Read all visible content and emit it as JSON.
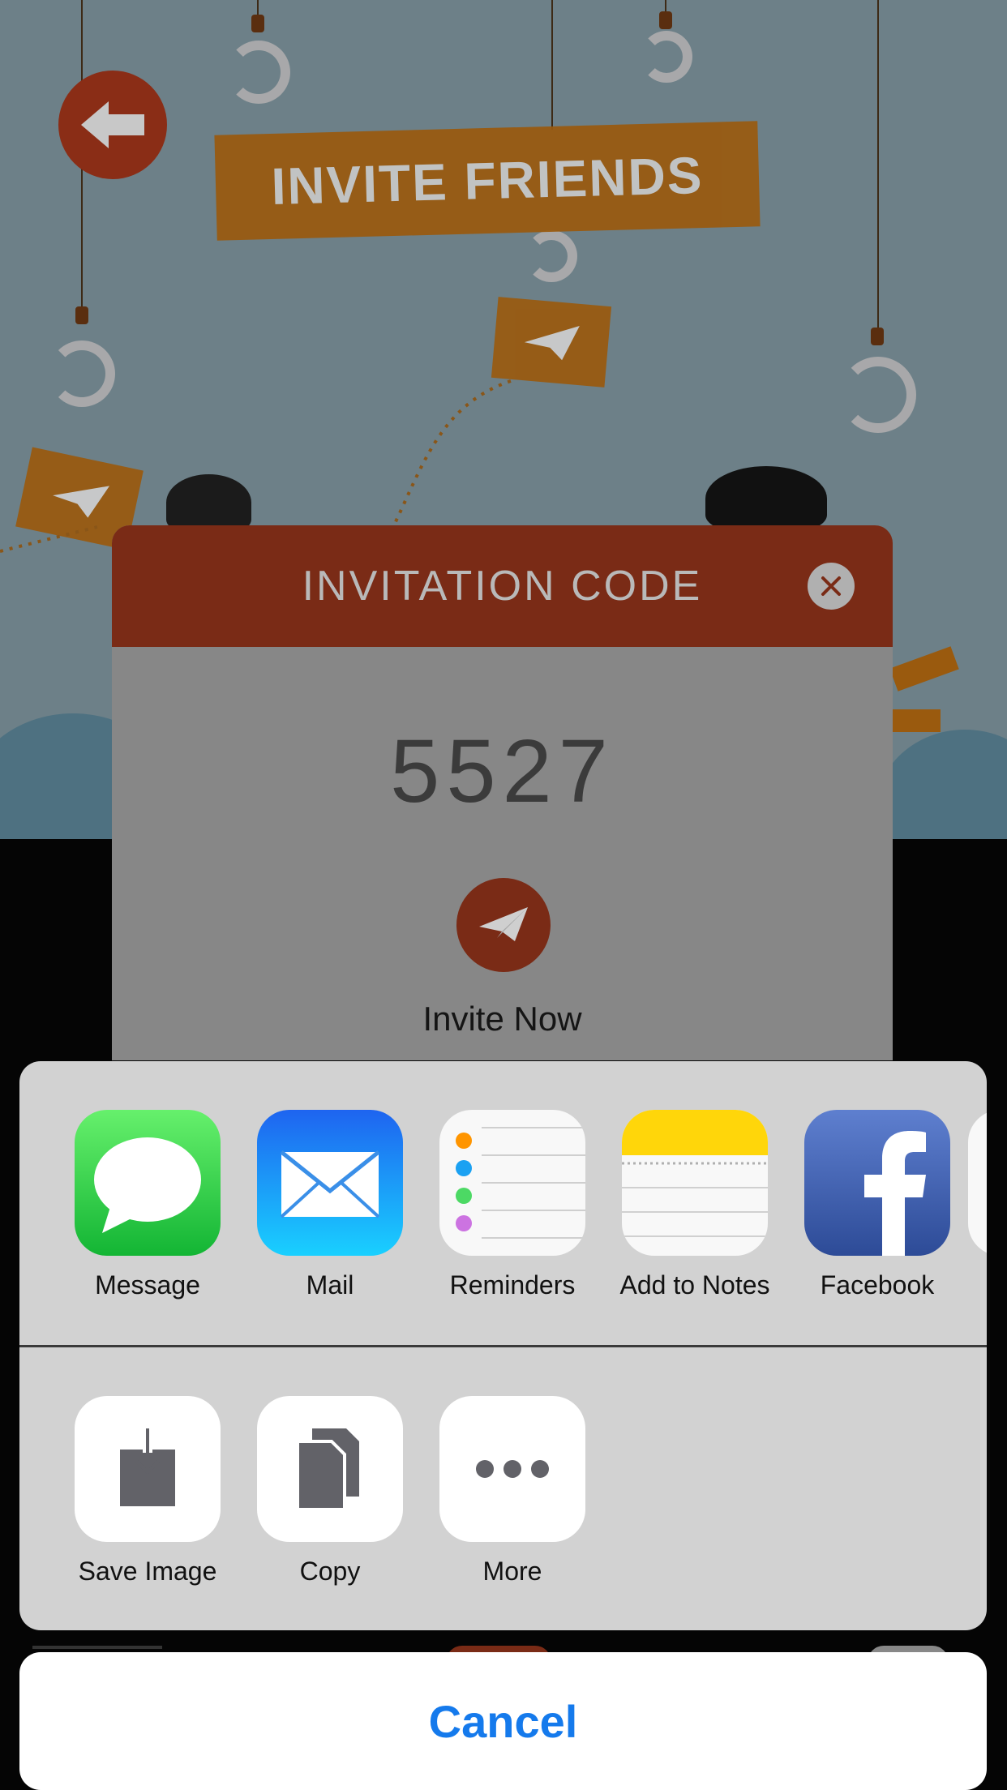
{
  "scene": {
    "banner_title": "INVITE FRIENDS"
  },
  "modal": {
    "title": "INVITATION CODE",
    "code": "5527",
    "invite_label": "Invite Now"
  },
  "share_sheet": {
    "apps": [
      {
        "label": "Message",
        "icon": "message-icon"
      },
      {
        "label": "Mail",
        "icon": "mail-icon"
      },
      {
        "label": "Reminders",
        "icon": "reminders-icon"
      },
      {
        "label": "Add to Notes",
        "icon": "notes-icon"
      },
      {
        "label": "Facebook",
        "icon": "facebook-icon"
      }
    ],
    "actions": [
      {
        "label": "Save Image",
        "icon": "save-image-icon"
      },
      {
        "label": "Copy",
        "icon": "copy-icon"
      },
      {
        "label": "More",
        "icon": "more-icon"
      }
    ],
    "cancel_label": "Cancel"
  },
  "colors": {
    "accent_blue": "#157aec",
    "modal_header": "#7a2b16",
    "banner": "#9a5a0e"
  }
}
